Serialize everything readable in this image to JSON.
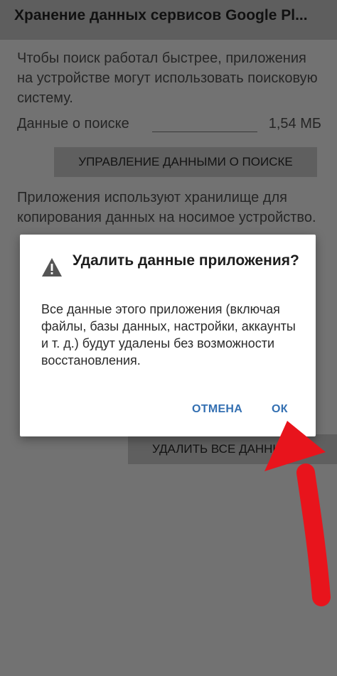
{
  "appbar": {
    "title": "Хранение данных сервисов Google Pl..."
  },
  "search_section": {
    "description": "Чтобы поиск работал быстрее, приложения на устройстве могут использовать поисковую систему.",
    "data_label": "Данные о поиске",
    "data_value": "1,54 МБ",
    "manage_button": "УПРАВЛЕНИЕ ДАННЫМИ О ПОИСКЕ"
  },
  "wear_section": {
    "description": "Приложения используют хранилище для копирования данных на носимое устройство."
  },
  "delete_all_button": "УДАЛИТЬ ВСЕ ДАННЫЕ",
  "dialog": {
    "icon": "warning-icon",
    "title": "Удалить данные приложения?",
    "message": "Все данные этого приложения (включая файлы, базы данных, настройки, аккаунты и т. д.) будут удалены без возможности восстановления.",
    "cancel_label": "ОТМЕНА",
    "ok_label": "ОК"
  },
  "annotation": {
    "arrow_color": "#e8141c"
  }
}
